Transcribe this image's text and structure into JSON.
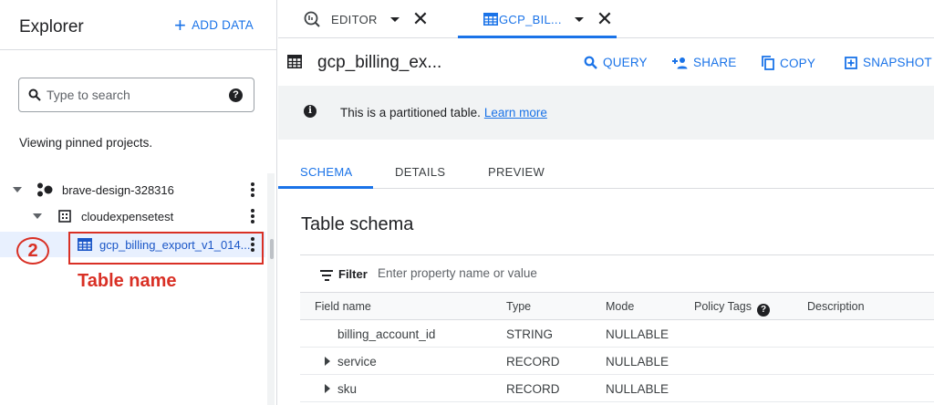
{
  "explorer": {
    "title": "Explorer",
    "add_data_label": "ADD DATA",
    "search_placeholder": "Type to search",
    "pinned_text": "Viewing pinned projects.",
    "tree": {
      "project": "brave-design-328316",
      "dataset": "cloudexpensetest",
      "table": "gcp_billing_export_v1_014..."
    }
  },
  "annotation": {
    "step_number": "2",
    "label": "Table name",
    "color": "#d93025"
  },
  "tabs": [
    {
      "label": "EDITOR"
    },
    {
      "label": "GCP_BIL..."
    }
  ],
  "toolbar": {
    "title": "gcp_billing_ex...",
    "query_label": "QUERY",
    "share_label": "SHARE",
    "copy_label": "COPY",
    "snapshot_label": "SNAPSHOT"
  },
  "banner": {
    "message": "This is a partitioned table.",
    "link": "Learn more"
  },
  "subtabs": [
    "SCHEMA",
    "DETAILS",
    "PREVIEW"
  ],
  "schema": {
    "title": "Table schema",
    "filter_label": "Filter",
    "filter_placeholder": "Enter property name or value",
    "columns": [
      "Field name",
      "Type",
      "Mode",
      "Policy Tags",
      "Description"
    ],
    "rows": [
      {
        "field": "billing_account_id",
        "type": "STRING",
        "mode": "NULLABLE",
        "expandable": false
      },
      {
        "field": "service",
        "type": "RECORD",
        "mode": "NULLABLE",
        "expandable": true
      },
      {
        "field": "sku",
        "type": "RECORD",
        "mode": "NULLABLE",
        "expandable": true
      }
    ]
  },
  "colors": {
    "accent": "#1a73e8",
    "annotation": "#d93025",
    "selected_row": "#e8f0fe"
  }
}
